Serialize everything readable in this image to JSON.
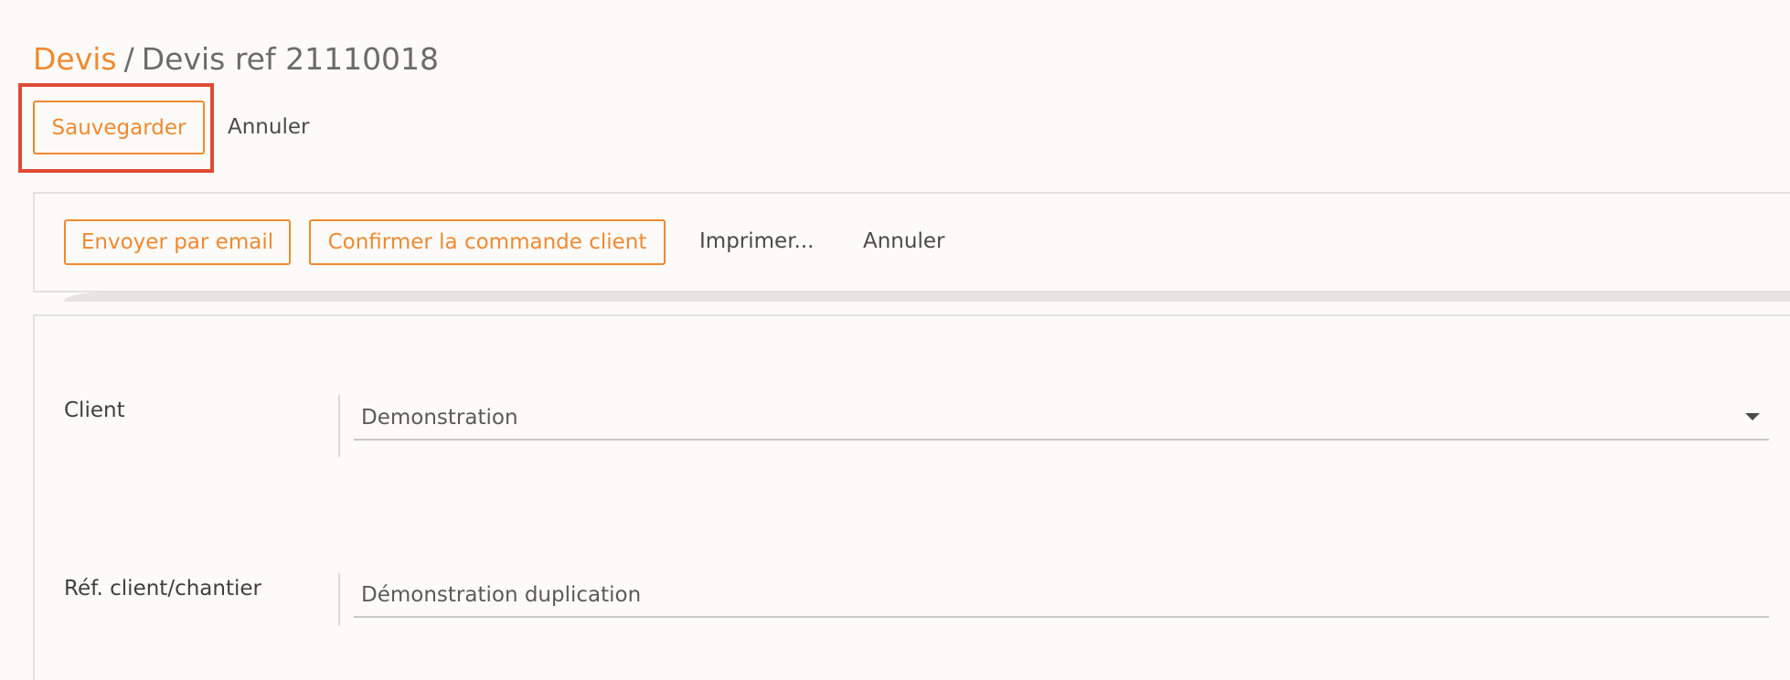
{
  "breadcrumb": {
    "parent": "Devis",
    "separator": "/",
    "current": "Devis ref 21110018"
  },
  "top_actions": {
    "save_label": "Sauvegarder",
    "cancel_label": "Annuler"
  },
  "action_bar": {
    "send_email_label": "Envoyer par email",
    "confirm_order_label": "Confirmer la commande client",
    "print_label": "Imprimer...",
    "cancel_label": "Annuler"
  },
  "form": {
    "client": {
      "label": "Client",
      "value": "Demonstration"
    },
    "reference": {
      "label": "Réf. client/chantier",
      "value": "Démonstration duplication"
    }
  },
  "colors": {
    "accent": "#f0892e",
    "highlight": "#e04a33"
  },
  "icons": {
    "dropdown": "chevron-down-icon"
  }
}
